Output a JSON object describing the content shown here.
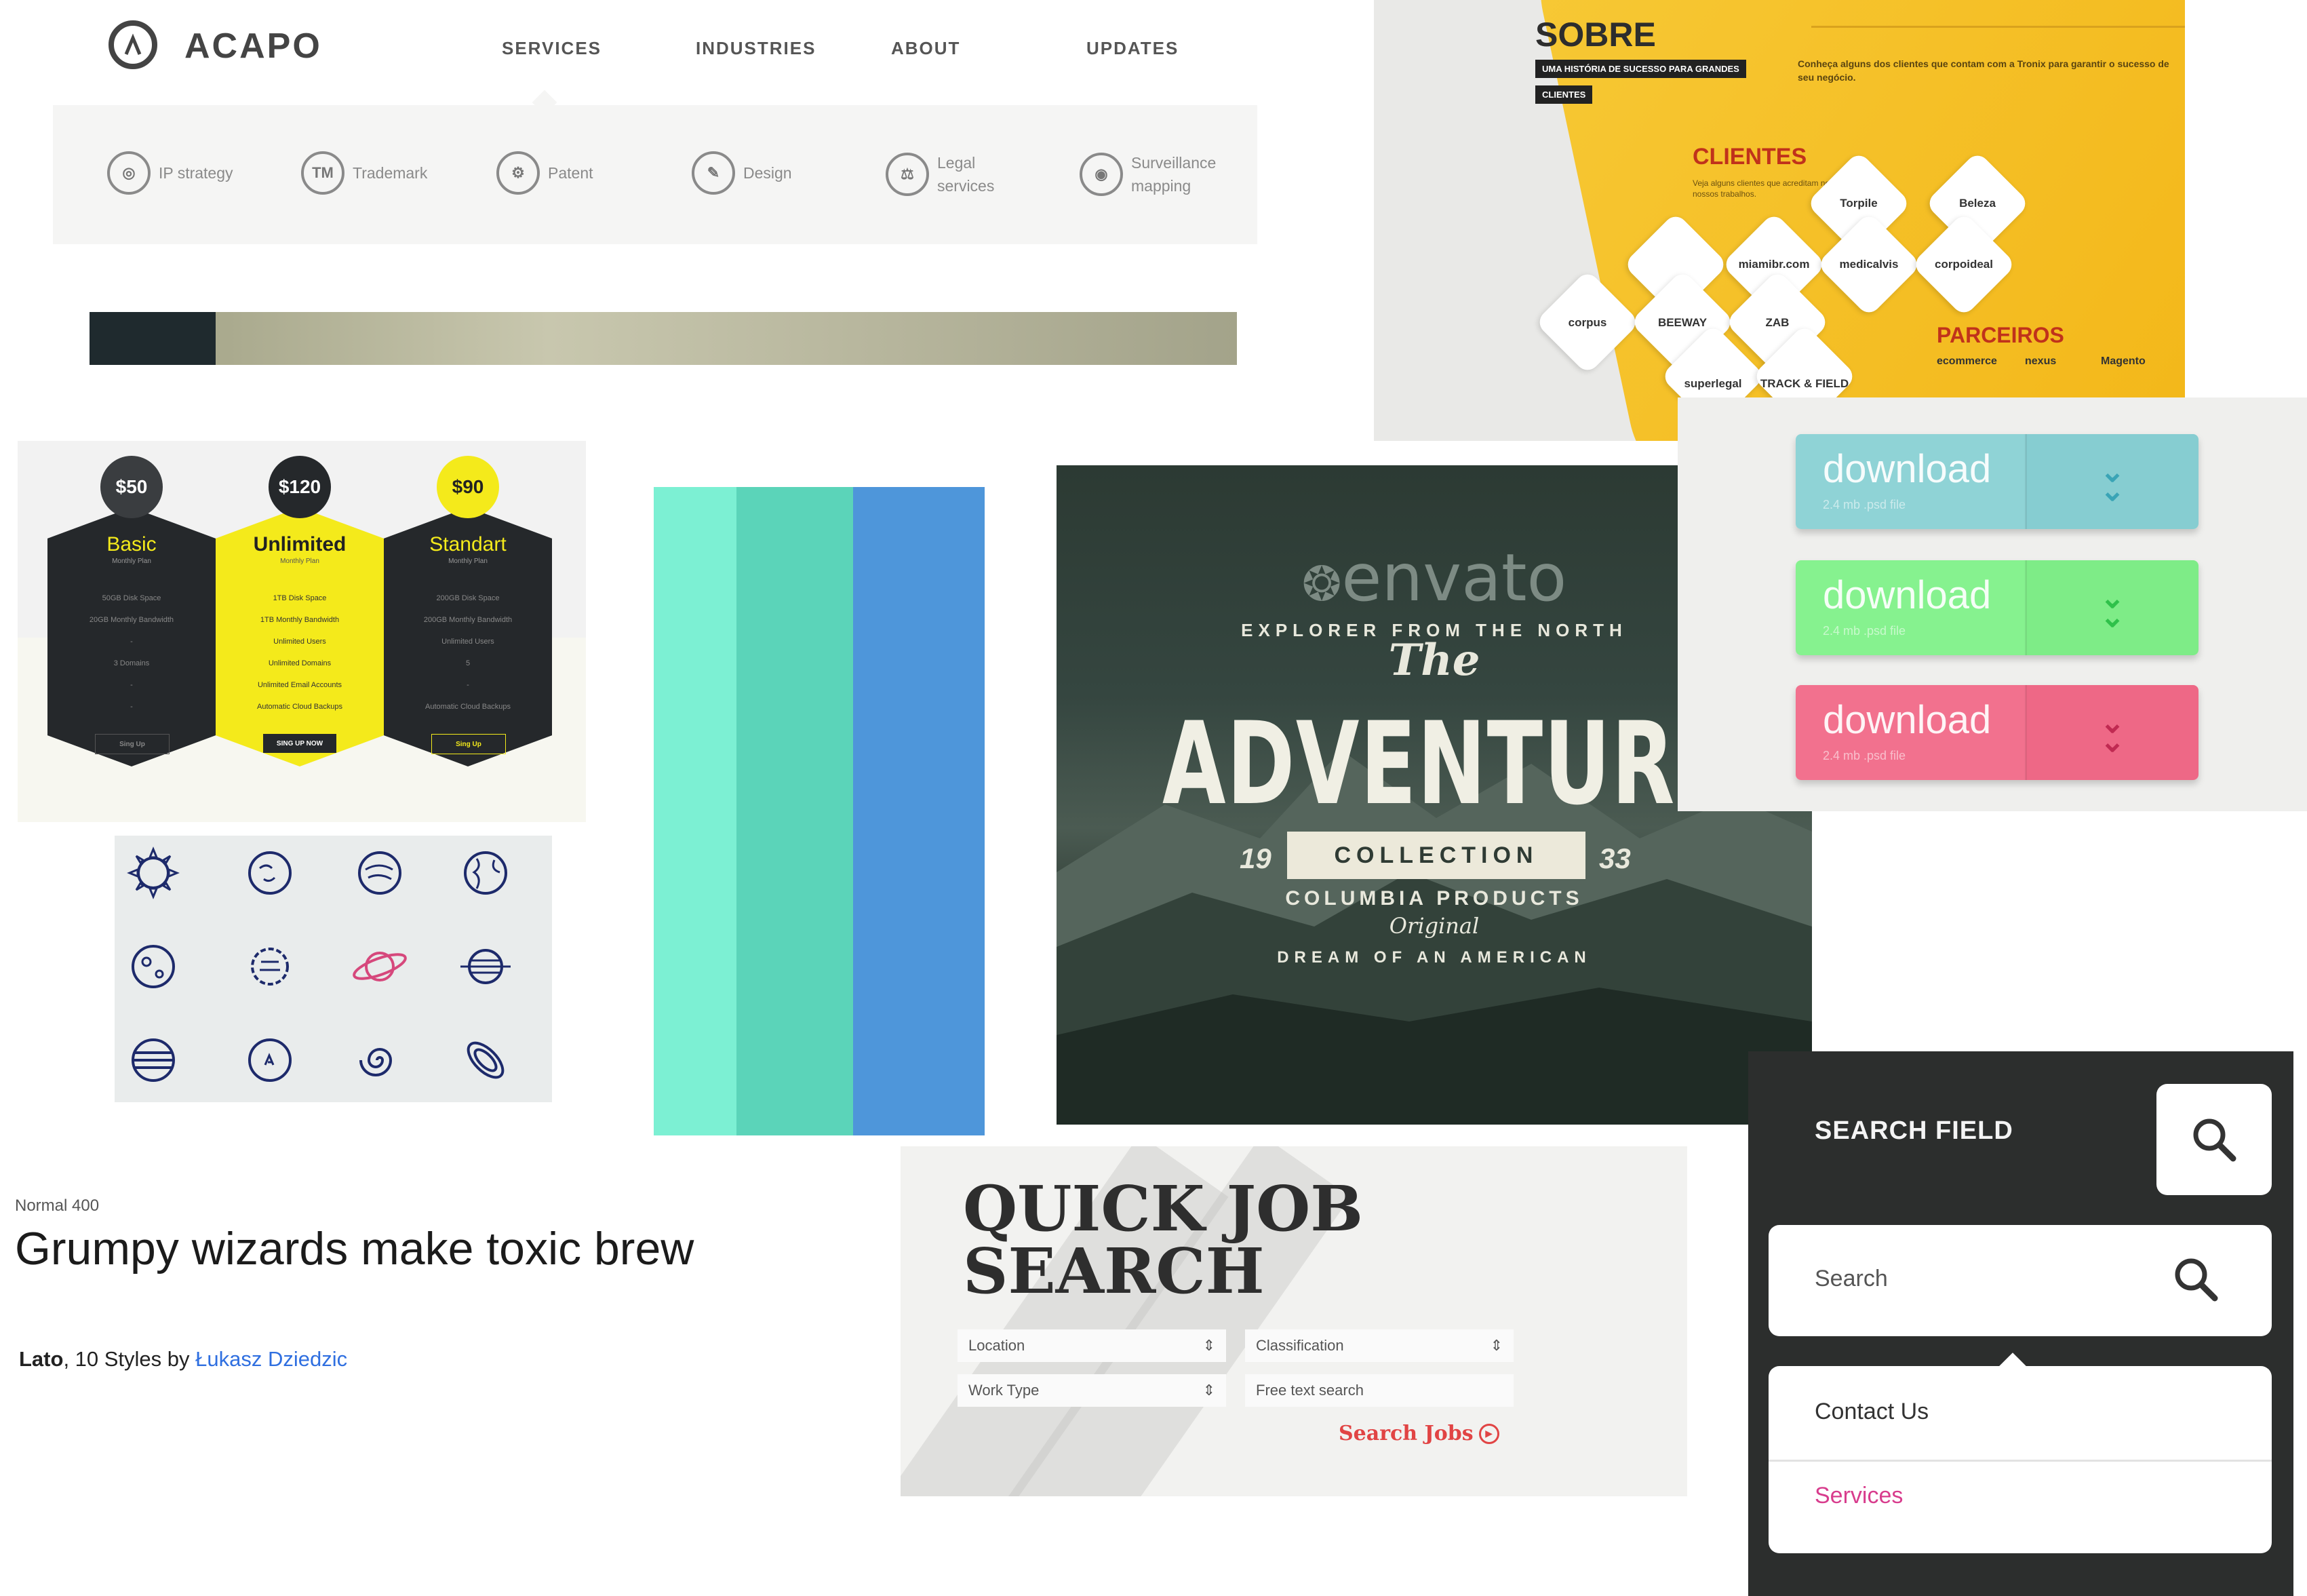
{
  "acapo": {
    "logo": "ACAPO",
    "nav": [
      "SERVICES",
      "INDUSTRIES",
      "ABOUT",
      "UPDATES"
    ],
    "submenu": [
      {
        "label": "IP strategy",
        "icon": "globe-icon"
      },
      {
        "label": "Trademark",
        "icon": "trademark-icon"
      },
      {
        "label": "Patent",
        "icon": "patent-icon"
      },
      {
        "label": "Design",
        "icon": "pencil-icon"
      },
      {
        "label": "Legal services",
        "icon": "gavel-icon"
      },
      {
        "label": "Surveillance mapping",
        "icon": "eye-icon"
      }
    ]
  },
  "sobre": {
    "title": "SOBRE",
    "tag1": "UMA HISTÓRIA DE SUCESSO PARA GRANDES",
    "tag2": "CLIENTES",
    "copy": "Conheça alguns dos clientes que contam com a Tronix para garantir o sucesso de seu negócio.",
    "clientes_title": "CLIENTES",
    "clientes_copy": "Veja alguns clientes que acreditam no resultado de nossos trabalhos.",
    "clients": [
      "Torpile",
      "Beleza",
      "miamibr.com",
      "medicalvis",
      "corpoideal",
      "corpus",
      "BEEWAY",
      "ZAB",
      "superlegal",
      "TRACK & FIELD"
    ],
    "parceiros_title": "PARCEIROS",
    "partners": [
      "ecommerce",
      "nexus",
      "Magento"
    ],
    "accent": "#f5be2a"
  },
  "pricing": {
    "plans": [
      {
        "price": "$50",
        "name": "Basic",
        "sub": "Monthly Plan",
        "features": [
          "50GB Disk Space",
          "20GB Monthly Bandwidth",
          "-",
          "3 Domains",
          "-",
          "-"
        ],
        "button": "Sing Up"
      },
      {
        "price": "$120",
        "name": "Unlimited",
        "sub": "Monthly Plan",
        "features": [
          "1TB Disk Space",
          "1TB Monthly Bandwidth",
          "Unlimited Users",
          "Unlimited Domains",
          "Unlimited Email Accounts",
          "Automatic Cloud Backups"
        ],
        "button": "SING UP NOW"
      },
      {
        "price": "$90",
        "name": "Standart",
        "sub": "Monthly Plan",
        "features": [
          "200GB Disk Space",
          "200GB Monthly Bandwidth",
          "Unlimited Users",
          "5",
          "-",
          "Automatic Cloud Backups"
        ],
        "button": "Sing Up"
      }
    ],
    "dark": "#25282b",
    "accent": "#f4ea1b"
  },
  "planets": {
    "icons": [
      "sun-icon",
      "planet-icon",
      "planet-icon",
      "globe-icon",
      "moon-icon",
      "planet-icon",
      "saturn-icon",
      "planet-icon",
      "jupiter-icon",
      "asteroid-icon",
      "galaxy-icon",
      "orbit-icon"
    ]
  },
  "swatches": [
    "#7cf0d3",
    "#5bd4b9",
    "#4e96da"
  ],
  "envato": {
    "logo": "envato",
    "arc": "EXPLORER FROM THE NORTH",
    "the": "The",
    "headline": "ADVENTURER",
    "ribbon": "COLLECTION",
    "year_left": "19",
    "year_right": "33",
    "products": "COLUMBIA PRODUCTS",
    "original": "Original",
    "dream": "DREAM OF AN AMERICAN"
  },
  "downloads": {
    "buttons": [
      {
        "label": "download",
        "sub": "2.4 mb .psd file",
        "color": "#8fd3d6",
        "arrow_color": "#3aa4b6"
      },
      {
        "label": "download",
        "sub": "2.4 mb .psd file",
        "color": "#86f28f",
        "arrow_color": "#2fc14a"
      },
      {
        "label": "download",
        "sub": "2.4 mb .psd file",
        "color": "#f2718e",
        "arrow_color": "#c02a52"
      }
    ]
  },
  "lato": {
    "weight": "Normal 400",
    "sample": "Grumpy wizards make toxic brew",
    "family": "Lato",
    "styles": ", 10 Styles by ",
    "author": "Łukasz Dziedzic"
  },
  "jobs": {
    "title_line1": "QUICK JOB",
    "title_line2": "SEARCH",
    "fields": [
      {
        "label": "Location",
        "type": "select"
      },
      {
        "label": "Classification",
        "type": "select"
      },
      {
        "label": "Work Type",
        "type": "select"
      },
      {
        "label": "Free text search",
        "type": "text"
      }
    ],
    "submit": "Search Jobs"
  },
  "search_widget": {
    "heading": "SEARCH FIELD",
    "placeholder": "Search",
    "menu": [
      {
        "label": "Contact Us",
        "color": "#333333"
      },
      {
        "label": "Services",
        "color": "#d83c8d"
      }
    ]
  }
}
